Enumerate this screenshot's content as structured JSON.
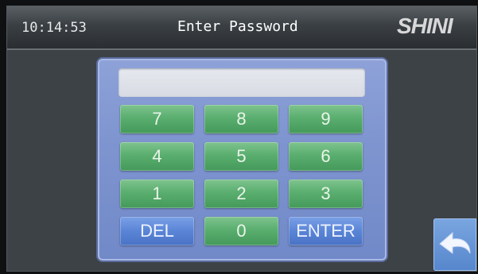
{
  "header": {
    "clock": "10:14:53",
    "title": "Enter Password",
    "logo_text": "SHINI"
  },
  "password_field": {
    "value": ""
  },
  "keypad": {
    "rows": [
      [
        "7",
        "8",
        "9"
      ],
      [
        "4",
        "5",
        "6"
      ],
      [
        "1",
        "2",
        "3"
      ],
      [
        "DEL",
        "0",
        "ENTER"
      ]
    ]
  },
  "colors": {
    "number_key": "#5aae6f",
    "action_key": "#5a85d6",
    "pad_background": "#7f95d0"
  },
  "icons": {
    "back": "undo-arrow-icon"
  }
}
